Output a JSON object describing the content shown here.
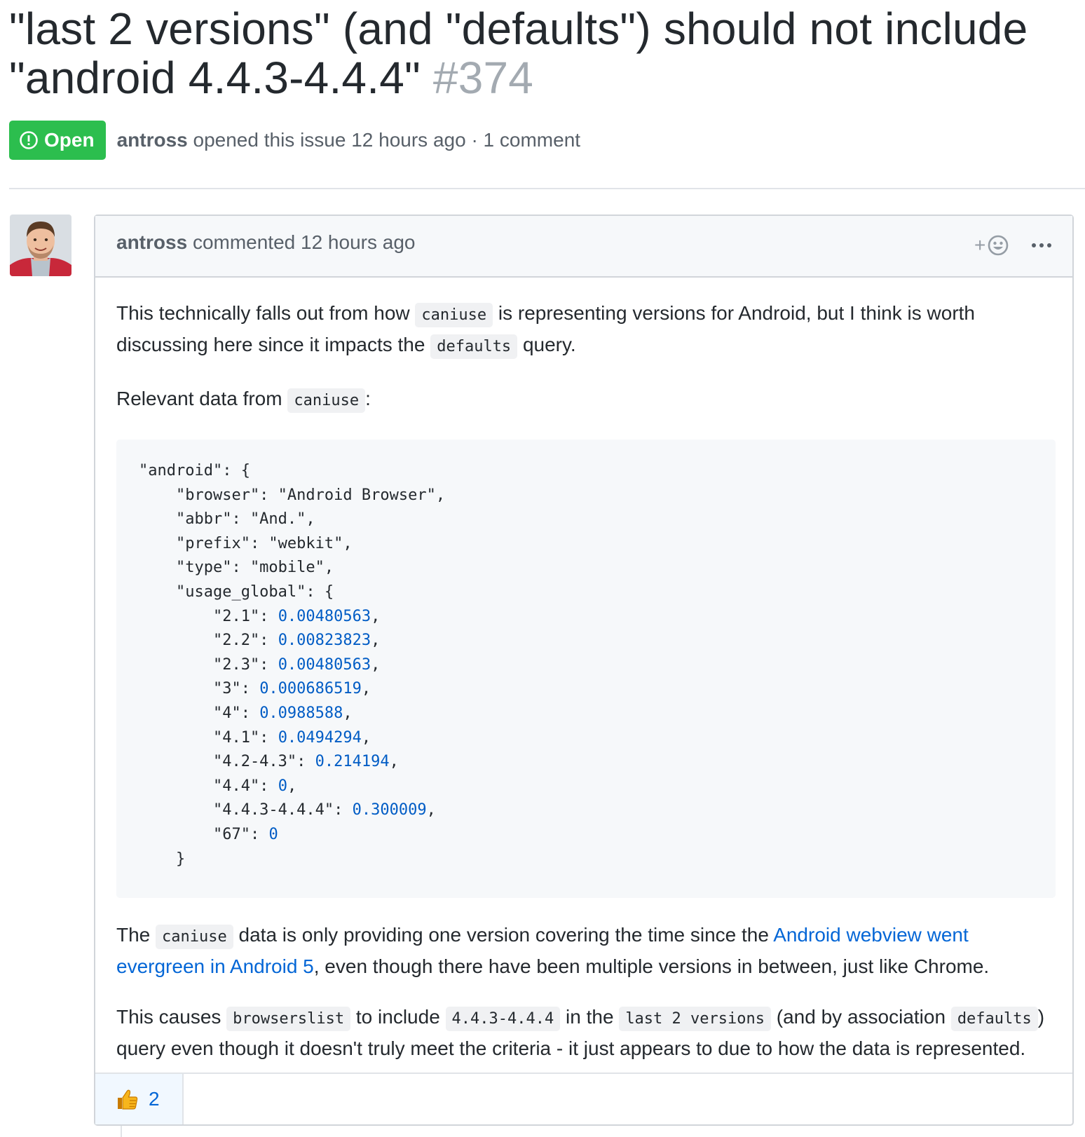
{
  "issue": {
    "title": "\"last 2 versions\" (and \"defaults\") should not include \"android 4.4.3-4.4.4\"",
    "number": "#374",
    "state": "Open",
    "author": "antross",
    "opened_text": "opened this issue 12 hours ago · 1 comment"
  },
  "comment": {
    "author": "antross",
    "header_text": "commented 12 hours ago",
    "add_reaction": "+",
    "body": {
      "p1_a": "This technically falls out from how ",
      "p1_code1": "caniuse",
      "p1_b": " is representing versions for Android, but I think is worth discussing here since it impacts the ",
      "p1_code2": "defaults",
      "p1_c": " query.",
      "p2_a": "Relevant data from ",
      "p2_code": "caniuse",
      "p2_b": ":",
      "code_lines": [
        "\"android\": {",
        "    \"browser\": \"Android Browser\",",
        "    \"abbr\": \"And.\",",
        "    \"prefix\": \"webkit\",",
        "    \"type\": \"mobile\",",
        "    \"usage_global\": {",
        "        \"2.1\": 0.00480563,",
        "        \"2.2\": 0.00823823,",
        "        \"2.3\": 0.00480563,",
        "        \"3\": 0.000686519,",
        "        \"4\": 0.0988588,",
        "        \"4.1\": 0.0494294,",
        "        \"4.2-4.3\": 0.214194,",
        "        \"4.4\": 0,",
        "        \"4.4.3-4.4.4\": 0.300009,",
        "        \"67\": 0",
        "    }"
      ],
      "p3_a": "The ",
      "p3_code": "caniuse",
      "p3_b": " data is only providing one version covering the time since the ",
      "p3_link": "Android webview went evergreen in Android 5",
      "p3_c": ", even though there have been multiple versions in between, just like Chrome.",
      "p4_a": "This causes ",
      "p4_code1": "browserslist",
      "p4_b": " to include ",
      "p4_code2": "4.4.3-4.4.4",
      "p4_c": " in the ",
      "p4_code3": "last 2 versions",
      "p4_d": " (and by association ",
      "p4_code4": "defaults",
      "p4_e": ") query even though it doesn't truly meet the criteria - it just appears to due to how the data is represented."
    },
    "reactions": [
      {
        "emoji": "thumbs-up-icon",
        "count": "2"
      }
    ]
  },
  "colors": {
    "open_green": "#2cbe4e",
    "link_blue": "#0366d6",
    "code_number": "#005cc5",
    "muted_text": "#586069"
  }
}
